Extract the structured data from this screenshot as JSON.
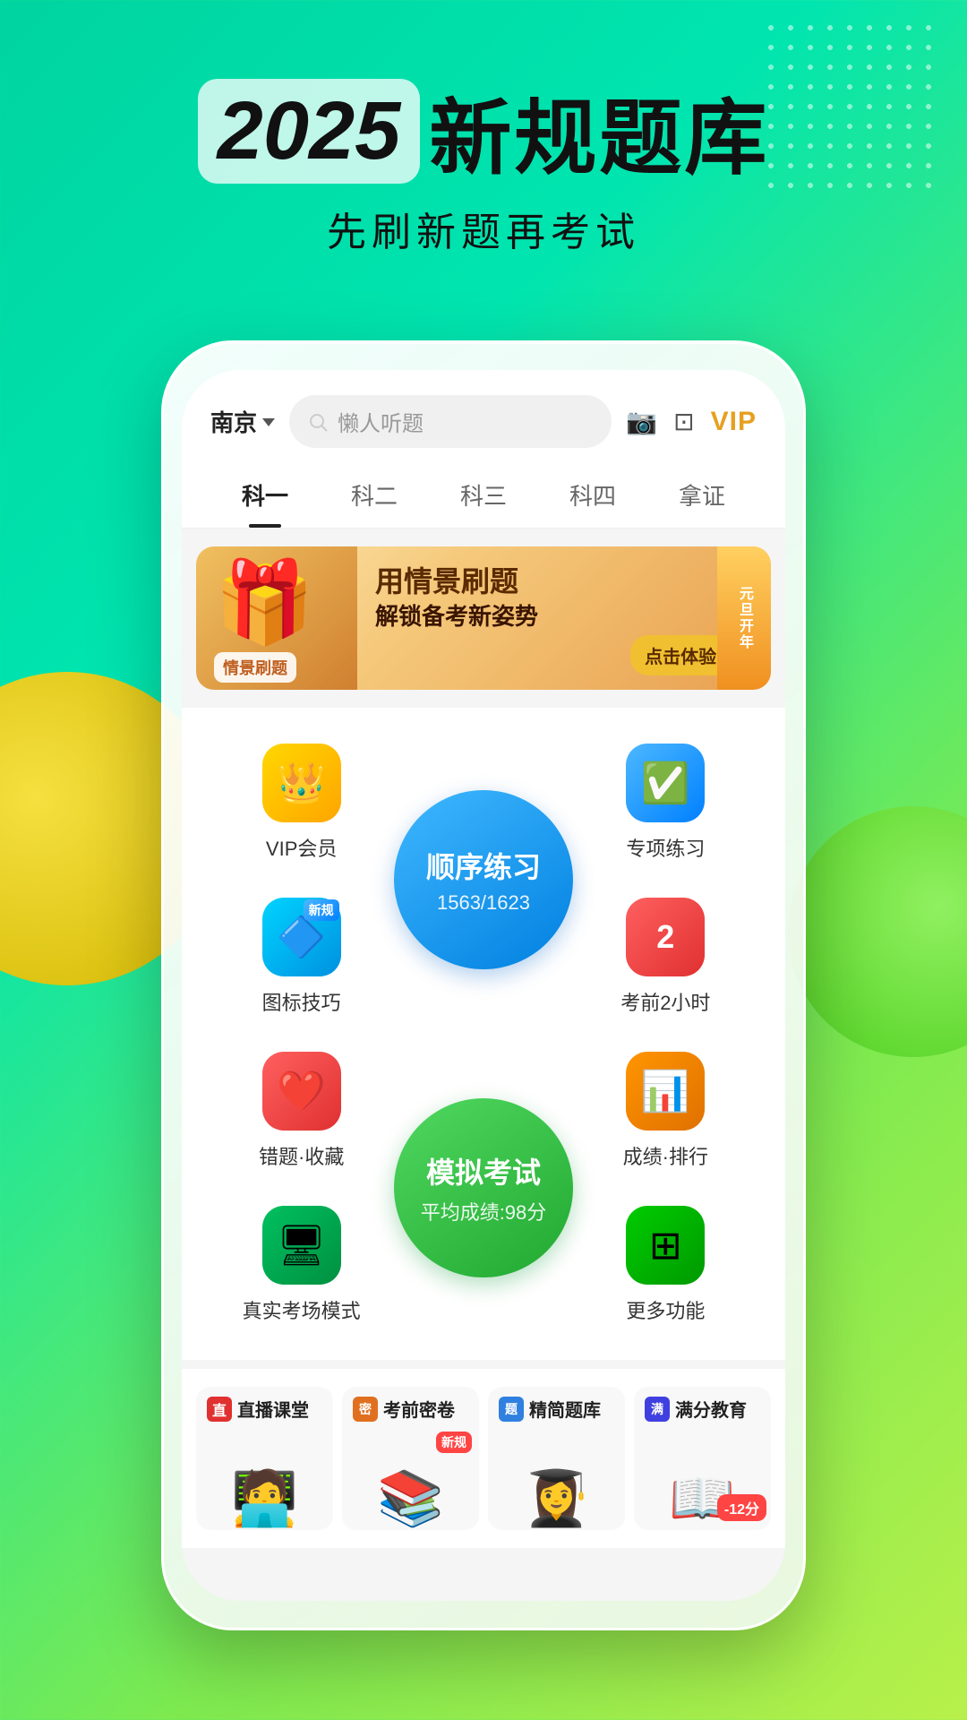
{
  "page": {
    "background_gradient_start": "#00d4a0",
    "background_gradient_end": "#b8f04a"
  },
  "header": {
    "year": "2025",
    "title_cn_part1": "新规题库",
    "subtitle": "先刷新题再考试"
  },
  "topbar": {
    "city": "南京",
    "search_placeholder": "懒人听题",
    "vip_label": "VIP"
  },
  "nav_tabs": [
    {
      "label": "科一",
      "active": true
    },
    {
      "label": "科二",
      "active": false
    },
    {
      "label": "科三",
      "active": false
    },
    {
      "label": "科四",
      "active": false
    },
    {
      "label": "拿证",
      "active": false
    }
  ],
  "banner": {
    "main_text": "用情景刷题",
    "sub_text": "解锁备考新姿势",
    "badge_text": "情景刷题",
    "cta_text": "点击体验 >>",
    "side_label": "元旦开年"
  },
  "grid_items": {
    "vip": {
      "label": "VIP会员"
    },
    "center_practice": {
      "main": "顺序练习",
      "progress": "1563/1623"
    },
    "special": {
      "label": "专项练习"
    },
    "new_rule": {
      "label": "图标技巧",
      "badge": "新规"
    },
    "exam2h": {
      "label": "考前2小时",
      "badge": "2"
    },
    "wrong": {
      "label": "错题·收藏"
    },
    "center_mock": {
      "main": "模拟考试",
      "sub": "平均成绩:98分"
    },
    "score": {
      "label": "成绩·排行"
    },
    "realexam": {
      "label": "真实考场模式"
    },
    "more": {
      "label": "更多功能"
    }
  },
  "bottom_cards": [
    {
      "title": "直播课堂",
      "icon_color": "#e03030",
      "has_new": false
    },
    {
      "title": "考前密卷",
      "icon_color": "#e07020",
      "has_new": true
    },
    {
      "title": "精简题库",
      "icon_color": "#3080e0",
      "has_new": false
    },
    {
      "title": "满分教育",
      "icon_color": "#4040e0",
      "has_discount": true,
      "discount": "-12分"
    }
  ]
}
